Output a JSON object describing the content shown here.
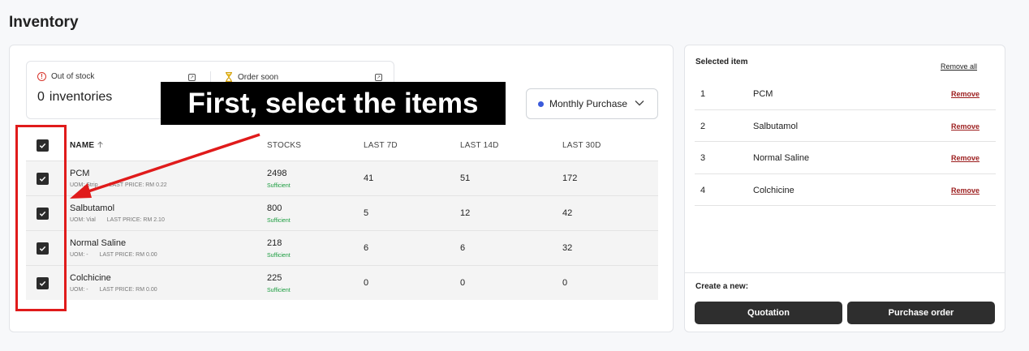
{
  "page": {
    "title": "Inventory"
  },
  "stats": {
    "out_of_stock": {
      "label": "Out of stock",
      "count": "0",
      "unit": "inventories"
    },
    "order_soon": {
      "label": "Order soon"
    }
  },
  "period_select": {
    "value": "Monthly Purchase"
  },
  "table": {
    "headers": {
      "name": "NAME",
      "stocks": "STOCKS",
      "last7": "LAST 7D",
      "last14": "LAST 14D",
      "last30": "LAST 30D"
    },
    "rows": [
      {
        "name": "PCM",
        "uom": "UOM: Strip",
        "price": "LAST PRICE: RM 0.22",
        "stock": "2498",
        "status": "Sufficient",
        "d7": "41",
        "d14": "51",
        "d30": "172"
      },
      {
        "name": "Salbutamol",
        "uom": "UOM: Vial",
        "price": "LAST PRICE: RM 2.10",
        "stock": "800",
        "status": "Sufficient",
        "d7": "5",
        "d14": "12",
        "d30": "42"
      },
      {
        "name": "Normal Saline",
        "uom": "UOM: -",
        "price": "LAST PRICE: RM 0.00",
        "stock": "218",
        "status": "Sufficient",
        "d7": "6",
        "d14": "6",
        "d30": "32"
      },
      {
        "name": "Colchicine",
        "uom": "UOM: -",
        "price": "LAST PRICE: RM 0.00",
        "stock": "225",
        "status": "Sufficient",
        "d7": "0",
        "d14": "0",
        "d30": "0"
      }
    ]
  },
  "selected": {
    "title": "Selected item",
    "remove_all": "Remove all",
    "remove_label": "Remove",
    "items": [
      {
        "idx": "1",
        "name": "PCM"
      },
      {
        "idx": "2",
        "name": "Salbutamol"
      },
      {
        "idx": "3",
        "name": "Normal Saline"
      },
      {
        "idx": "4",
        "name": "Colchicine"
      }
    ],
    "create_label": "Create a new:",
    "quotation": "Quotation",
    "purchase_order": "Purchase order"
  },
  "annotation": {
    "callout": "First, select the items"
  },
  "colors": {
    "accent": "#3b5bdb",
    "status_ok": "#1a9c3e",
    "remove": "#9b1c1c",
    "annotation_red": "#e01b1b"
  }
}
